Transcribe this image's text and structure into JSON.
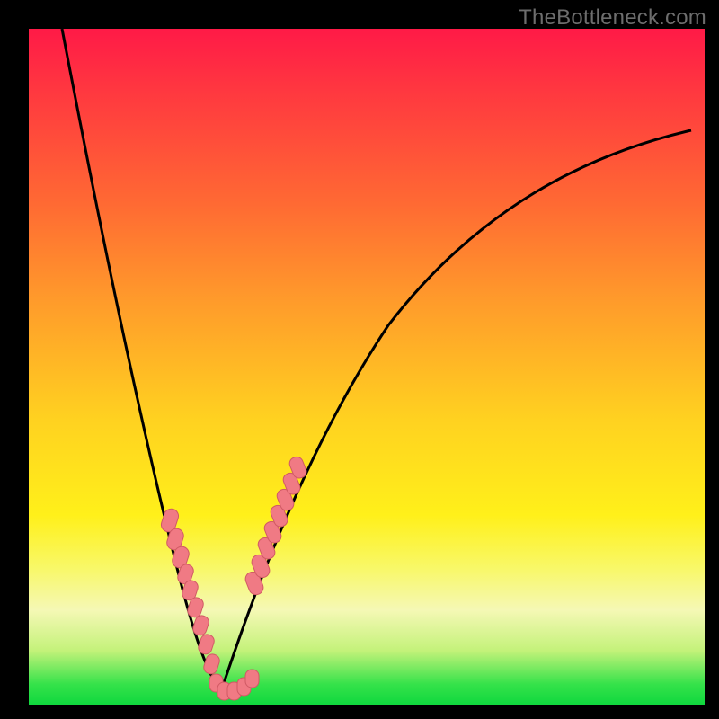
{
  "watermark": "TheBottleneck.com",
  "colors": {
    "background": "#000000",
    "gradient_top": "#ff1a47",
    "gradient_bottom": "#10d83e",
    "curve": "#000000",
    "marker_fill": "#f07a84",
    "marker_stroke": "#d05a64"
  },
  "chart_data": {
    "type": "line",
    "title": "",
    "xlabel": "",
    "ylabel": "",
    "xlim": [
      0,
      100
    ],
    "ylim": [
      0,
      100
    ],
    "grid": false,
    "legend": false,
    "series": [
      {
        "name": "left-curve",
        "x": [
          5,
          7,
          9,
          11,
          13,
          15,
          17,
          19,
          21,
          23,
          25,
          27,
          28.5
        ],
        "y": [
          100,
          90,
          81,
          72,
          64,
          56,
          48,
          40,
          32,
          24,
          16,
          8,
          2
        ]
      },
      {
        "name": "right-curve",
        "x": [
          28.5,
          31,
          34,
          38,
          42,
          47,
          53,
          60,
          68,
          77,
          87,
          98
        ],
        "y": [
          2,
          10,
          20,
          32,
          42,
          51,
          59,
          66,
          72,
          77,
          81,
          85
        ]
      },
      {
        "name": "left-markers",
        "type": "scatter",
        "x": [
          20.5,
          21.5,
          22.3,
          23.0,
          23.8,
          24.5,
          25.3,
          26.0,
          26.8
        ],
        "y": [
          28,
          25,
          22,
          19,
          16,
          13,
          10,
          7,
          4
        ]
      },
      {
        "name": "right-markers",
        "type": "scatter",
        "x": [
          33.0,
          33.8,
          34.6,
          35.4,
          36.2,
          37.0,
          37.8,
          38.6
        ],
        "y": [
          18,
          21,
          24,
          26,
          29,
          31,
          33,
          35
        ]
      },
      {
        "name": "bottom-markers",
        "type": "scatter",
        "x": [
          27.5,
          28.5,
          29.5,
          30.5,
          31.5
        ],
        "y": [
          2,
          2,
          2,
          2.5,
          3
        ]
      }
    ]
  }
}
